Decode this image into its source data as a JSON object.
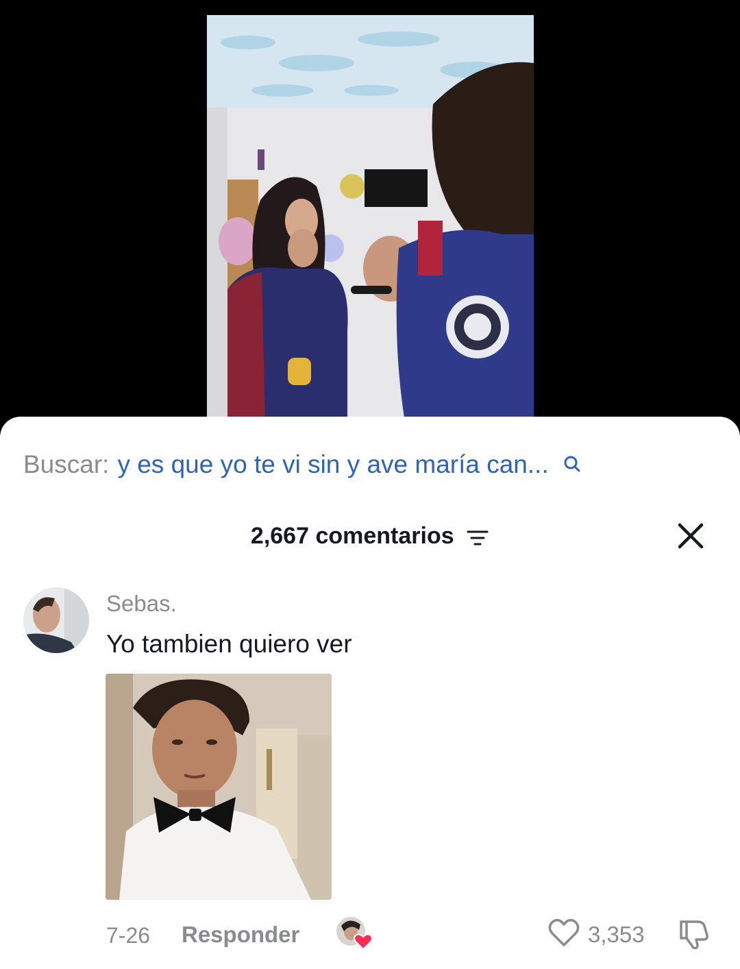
{
  "search": {
    "label": "Buscar:",
    "query": "y es que yo te vi sin y ave maría can..."
  },
  "comments_header": {
    "count_label": "2,667 comentarios"
  },
  "comment": {
    "username": "Sebas.",
    "text": "Yo tambien quiero ver",
    "timestamp": "7-26",
    "reply_label": "Responder",
    "like_count": "3,353"
  },
  "colors": {
    "accent_query": "#2f64b5",
    "muted_text": "#8a8b90",
    "primary_text": "#161823",
    "heart_red": "#fe2c55"
  },
  "icons": [
    "search-icon",
    "sort-icon",
    "close-icon",
    "heart-icon",
    "dislike-icon",
    "creator-liked-heart-icon"
  ]
}
